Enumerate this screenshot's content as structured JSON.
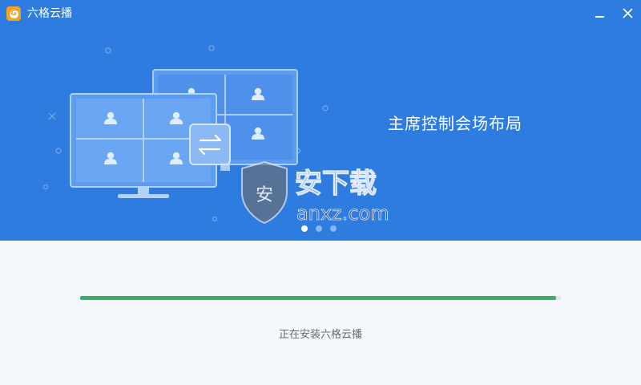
{
  "window": {
    "title": "六格云播",
    "logo_glyph": "G",
    "accent_color": "#2e7ce0",
    "controls": {
      "minimize_icon": "minimize-icon",
      "close_icon": "close-icon"
    }
  },
  "banner": {
    "slide_title": "主席控制会场布局",
    "carousel": {
      "count": 3,
      "active_index": 0
    },
    "illustration_icons": [
      "monitor-icon",
      "user-icon",
      "swap-arrows-icon"
    ]
  },
  "watermark": {
    "text": "安下载",
    "domain": "anxz.com",
    "badge_glyph": "安"
  },
  "install": {
    "progress_fraction": 0.99,
    "progress_color": "#3dae6a",
    "status": "正在安装六格云播"
  }
}
